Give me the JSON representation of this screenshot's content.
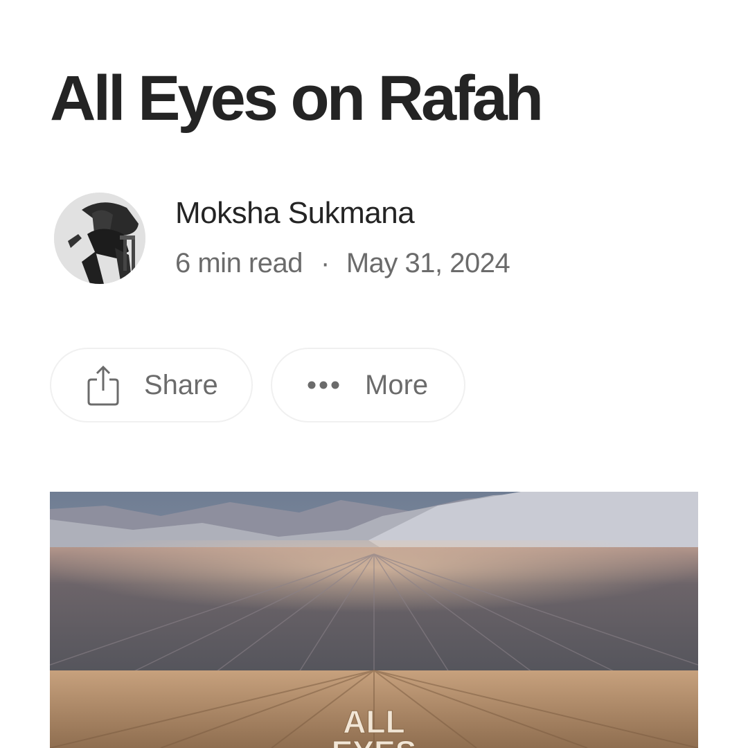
{
  "article": {
    "title": "All Eyes on Rafah",
    "author": "Moksha Sukmana",
    "read_time": "6 min read",
    "separator": "·",
    "date": "May 31, 2024"
  },
  "actions": {
    "share_label": "Share",
    "more_label": "More"
  },
  "icons": {
    "share": "share-icon",
    "more": "more-dots-icon"
  },
  "hero_image": {
    "visible_text": "ALL EYES"
  },
  "colors": {
    "title_text": "#242424",
    "meta_text": "#6b6b6b",
    "pill_border": "#f0f0f0"
  }
}
